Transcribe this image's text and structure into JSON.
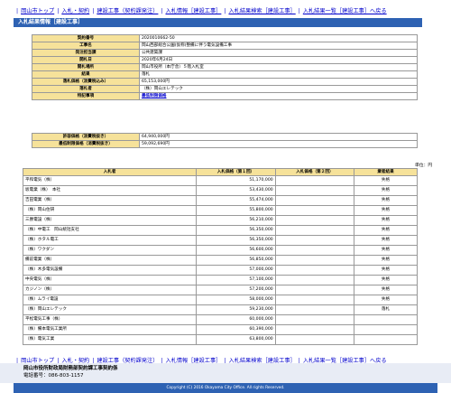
{
  "nav": {
    "links": [
      "岡山市トップ",
      "入札・契約",
      "建設工事（契約課発注）",
      "入札情報［建設工事］",
      "入札結果検索［建設工事］",
      "入札結果一覧［建設工事］へ戻る"
    ]
  },
  "title": "入札結果情報［建設工事］",
  "info": {
    "rows": [
      {
        "k": "契約番号",
        "v": "2020010662-50"
      },
      {
        "k": "工事名",
        "v": "岡山西部総合公園(仮称)整備に伴う電気設備工事"
      },
      {
        "k": "発注担当課",
        "v": "公共建築課"
      },
      {
        "k": "開札日",
        "v": "2020年6月24日"
      },
      {
        "k": "開札場所",
        "v": "岡山市役所（本庁舎）５階入札室"
      },
      {
        "k": "結果",
        "v": "落札"
      },
      {
        "k": "落札価格（消費税込み）",
        "v": "65,153,000円"
      },
      {
        "k": "落札者",
        "v": "（株）岡山エレテック"
      },
      {
        "k": "特記事項",
        "v": "最低制限価格",
        "link": true
      }
    ],
    "prices": [
      {
        "k": "許容価格（消費税抜き）",
        "v": "64,940,000円"
      },
      {
        "k": "最低制限価格（消費税抜き）",
        "v": "59,092,690円"
      }
    ]
  },
  "unit_label": "単位：円",
  "bids": {
    "headers": [
      "入札者",
      "入札価格（第１回）",
      "入札価格（第２回）",
      "業者結果"
    ],
    "rows": [
      {
        "name": "平和電気（株）",
        "p1": "51,170,000",
        "p2": "",
        "result": "失格"
      },
      {
        "name": "坂電業（株）　本社",
        "p1": "53,430,000",
        "p2": "",
        "result": "失格"
      },
      {
        "name": "吉田電業（株）",
        "p1": "55,474,000",
        "p2": "",
        "result": "失格"
      },
      {
        "name": "（株）岡山住研",
        "p1": "55,800,000",
        "p2": "",
        "result": "失格"
      },
      {
        "name": "三勝電設（株）",
        "p1": "56,210,000",
        "p2": "",
        "result": "失格"
      },
      {
        "name": "（株）中電工　岡山統括支社",
        "p1": "56,350,000",
        "p2": "",
        "result": "失格"
      },
      {
        "name": "（株）ホタル電工",
        "p1": "56,350,000",
        "p2": "",
        "result": "失格"
      },
      {
        "name": "（株）ワクダン",
        "p1": "56,600,000",
        "p2": "",
        "result": "失格"
      },
      {
        "name": "備前電業（株）",
        "p1": "56,850,000",
        "p2": "",
        "result": "失格"
      },
      {
        "name": "（株）木多電気設備",
        "p1": "57,000,000",
        "p2": "",
        "result": "失格"
      },
      {
        "name": "中央電気（株）",
        "p1": "57,100,000",
        "p2": "",
        "result": "失格"
      },
      {
        "name": "カジノン（株）",
        "p1": "57,200,000",
        "p2": "",
        "result": "失格"
      },
      {
        "name": "（株）ムライ電設",
        "p1": "58,000,000",
        "p2": "",
        "result": "失格"
      },
      {
        "name": "（株）岡山エレテック",
        "p1": "59,230,000",
        "p2": "",
        "result": "落札"
      },
      {
        "name": "平松電気工事（株）",
        "p1": "60,000,000",
        "p2": "",
        "result": ""
      },
      {
        "name": "（株）備本電気工業所",
        "p1": "60,390,000",
        "p2": "",
        "result": ""
      },
      {
        "name": "（株）電気工業",
        "p1": "63,800,000",
        "p2": "",
        "result": ""
      }
    ]
  },
  "footer": {
    "org": "岡山市役所財政局財務部契約課工事契約係",
    "phone": "電話番号：086-803-1157"
  },
  "copyright": "Copyright (C) 2016 Okayama City Office. All rights Reserved."
}
